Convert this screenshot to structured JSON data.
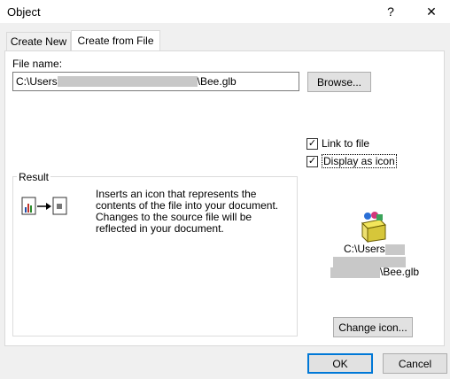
{
  "window": {
    "title": "Object",
    "help_label": "?",
    "close_label": "✕"
  },
  "tabs": [
    {
      "label": "Create New"
    },
    {
      "label": "Create from File"
    }
  ],
  "file": {
    "label": "File name:",
    "value_prefix": "C:\\Users",
    "value_suffix": "\\Bee.glb",
    "browse_label": "Browse..."
  },
  "options": {
    "link_label": "Link to file",
    "link_checked": true,
    "display_icon_label": "Display as icon",
    "display_icon_checked": true
  },
  "result": {
    "legend": "Result",
    "text": "Inserts an icon that represents the contents of the file into your document. Changes to the source file will be reflected in your document."
  },
  "icon_preview": {
    "caption_prefix": "C:\\Users",
    "caption_suffix": "\\Bee.glb",
    "change_icon_label": "Change icon..."
  },
  "footer": {
    "ok_label": "OK",
    "cancel_label": "Cancel"
  }
}
